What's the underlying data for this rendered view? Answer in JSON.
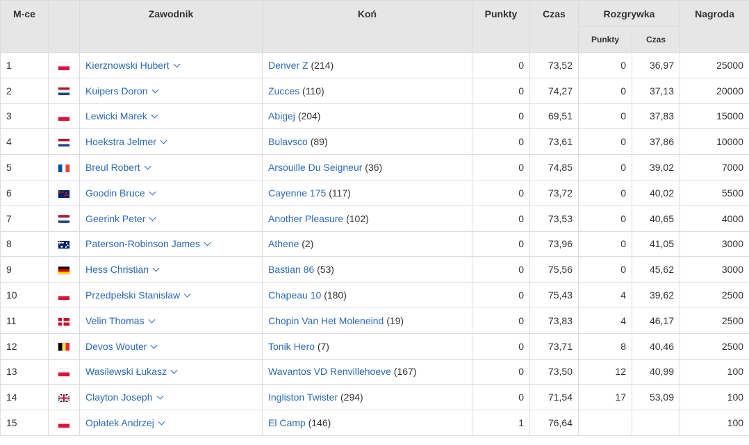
{
  "header": {
    "place": "M-ce",
    "rider": "Zawodnik",
    "horse": "Koń",
    "points": "Punkty",
    "time": "Czas",
    "jumpoff": "Rozgrywka",
    "jumpoff_points": "Punkty",
    "jumpoff_time": "Czas",
    "prize": "Nagroda"
  },
  "colors": {
    "header_bg": "#e6e6e6",
    "link": "#2a6ab5",
    "border": "#dcdcdc"
  },
  "rows": [
    {
      "place": "1",
      "flag": "pl",
      "rider": "Kierznowski Hubert",
      "horse": "Denver Z",
      "horse_id": "(214)",
      "points": "0",
      "time": "73,52",
      "jo_points": "0",
      "jo_time": "36,97",
      "prize": "25000"
    },
    {
      "place": "2",
      "flag": "nl",
      "rider": "Kuipers Doron",
      "horse": "Zucces",
      "horse_id": "(110)",
      "points": "0",
      "time": "74,27",
      "jo_points": "0",
      "jo_time": "37,13",
      "prize": "20000"
    },
    {
      "place": "3",
      "flag": "pl",
      "rider": "Lewicki Marek",
      "horse": "Abigej",
      "horse_id": "(204)",
      "points": "0",
      "time": "69,51",
      "jo_points": "0",
      "jo_time": "37,83",
      "prize": "15000"
    },
    {
      "place": "4",
      "flag": "nl",
      "rider": "Hoekstra Jelmer",
      "horse": "Bulavsco",
      "horse_id": "(89)",
      "points": "0",
      "time": "73,61",
      "jo_points": "0",
      "jo_time": "37,86",
      "prize": "10000"
    },
    {
      "place": "5",
      "flag": "fr",
      "rider": "Breul Robert",
      "horse": "Arsouille Du Seigneur",
      "horse_id": "(36)",
      "points": "0",
      "time": "74,85",
      "jo_points": "0",
      "jo_time": "39,02",
      "prize": "7000"
    },
    {
      "place": "6",
      "flag": "nz",
      "rider": "Goodin Bruce",
      "horse": "Cayenne 175",
      "horse_id": "(117)",
      "points": "0",
      "time": "73,72",
      "jo_points": "0",
      "jo_time": "40,02",
      "prize": "5500"
    },
    {
      "place": "7",
      "flag": "nl",
      "rider": "Geerink Peter",
      "horse": "Another Pleasure",
      "horse_id": "(102)",
      "points": "0",
      "time": "73,53",
      "jo_points": "0",
      "jo_time": "40,65",
      "prize": "4000"
    },
    {
      "place": "8",
      "flag": "au",
      "rider": "Paterson-Robinson James",
      "horse": "Athene",
      "horse_id": "(2)",
      "points": "0",
      "time": "73,96",
      "jo_points": "0",
      "jo_time": "41,05",
      "prize": "3000"
    },
    {
      "place": "9",
      "flag": "de",
      "rider": "Hess Christian",
      "horse": "Bastian 86",
      "horse_id": "(53)",
      "points": "0",
      "time": "75,56",
      "jo_points": "0",
      "jo_time": "45,62",
      "prize": "3000"
    },
    {
      "place": "10",
      "flag": "pl",
      "rider": "Przedpełski Stanisław",
      "horse": "Chapeau 10",
      "horse_id": "(180)",
      "points": "0",
      "time": "75,43",
      "jo_points": "4",
      "jo_time": "39,62",
      "prize": "2500"
    },
    {
      "place": "11",
      "flag": "dk",
      "rider": "Velin Thomas",
      "horse": "Chopin Van Het Moleneind",
      "horse_id": "(19)",
      "points": "0",
      "time": "73,83",
      "jo_points": "4",
      "jo_time": "46,17",
      "prize": "2500"
    },
    {
      "place": "12",
      "flag": "be",
      "rider": "Devos Wouter",
      "horse": "Tonik Hero",
      "horse_id": "(7)",
      "points": "0",
      "time": "73,71",
      "jo_points": "8",
      "jo_time": "40,46",
      "prize": "2500"
    },
    {
      "place": "13",
      "flag": "pl",
      "rider": "Wasilewski Łukasz",
      "horse": "Wavantos VD Renvillehoeve",
      "horse_id": "(167)",
      "points": "0",
      "time": "73,50",
      "jo_points": "12",
      "jo_time": "40,99",
      "prize": "100"
    },
    {
      "place": "14",
      "flag": "gb",
      "rider": "Clayton Joseph",
      "horse": "Ingliston Twister",
      "horse_id": "(294)",
      "points": "0",
      "time": "71,54",
      "jo_points": "17",
      "jo_time": "53,09",
      "prize": "100"
    },
    {
      "place": "15",
      "flag": "pl",
      "rider": "Opłatek Andrzej",
      "horse": "El Camp",
      "horse_id": "(146)",
      "points": "1",
      "time": "76,64",
      "jo_points": "",
      "jo_time": "",
      "prize": "100"
    }
  ]
}
